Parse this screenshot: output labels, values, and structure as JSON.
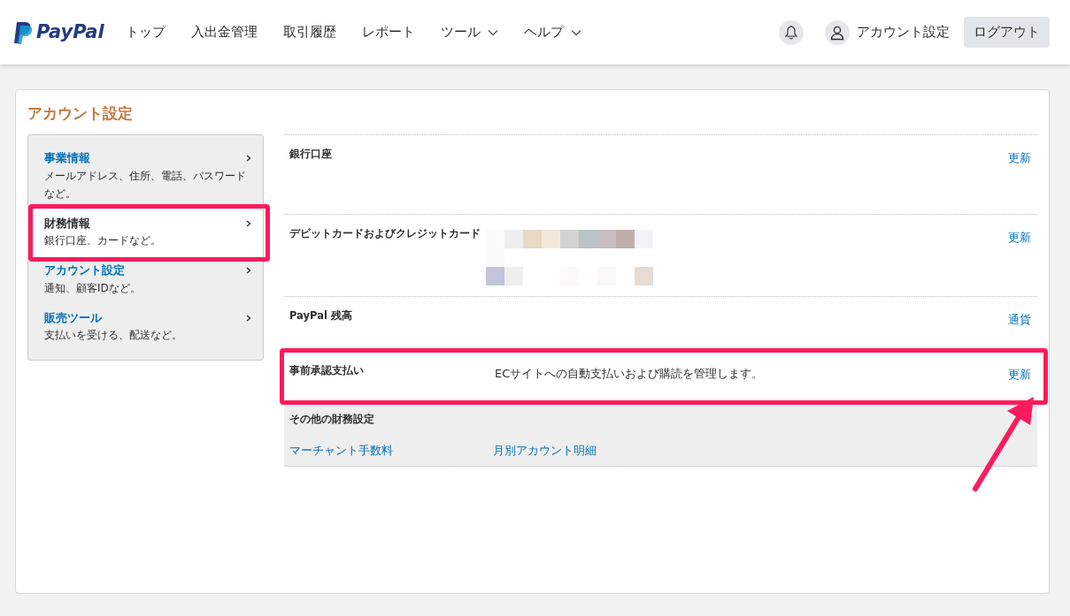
{
  "brand": "PayPal",
  "nav": [
    {
      "label": "トップ",
      "dropdown": false
    },
    {
      "label": "入出金管理",
      "dropdown": false
    },
    {
      "label": "取引履歴",
      "dropdown": false
    },
    {
      "label": "レポート",
      "dropdown": false
    },
    {
      "label": "ツール",
      "dropdown": true
    },
    {
      "label": "ヘルプ",
      "dropdown": true
    }
  ],
  "account_link": "アカウント設定",
  "logout": "ログアウト",
  "page_title": "アカウント設定",
  "sidebar": {
    "items": [
      {
        "title": "事業情報",
        "description": "メールアドレス、住所、電話、パスワードなど。",
        "selected": false,
        "highlighted": false
      },
      {
        "title": "財務情報",
        "description": "銀行口座、カードなど。",
        "selected": true,
        "highlighted": true
      },
      {
        "title": "アカウント設定",
        "description": "通知、顧客IDなど。",
        "selected": false,
        "highlighted": false
      },
      {
        "title": "販売ツール",
        "description": "支払いを受ける、配送など。",
        "selected": false,
        "highlighted": false
      }
    ]
  },
  "rows": [
    {
      "kind": "plain",
      "label": "銀行口座",
      "action": "更新",
      "highlighted": false
    },
    {
      "kind": "image",
      "label": "デビットカードおよびクレジットカード",
      "action": "更新",
      "highlighted": false
    },
    {
      "kind": "plain",
      "label": "PayPal 残高",
      "action": "通貨",
      "highlighted": false
    },
    {
      "kind": "text",
      "label": "事前承認支払い",
      "description": "ECサイトへの自動支払いおよび購読を管理します。",
      "action": "更新",
      "highlighted": true
    }
  ],
  "other": {
    "title": "その他の財務設定",
    "links": [
      "マーチャント手数料",
      "月別アカウント明細"
    ]
  }
}
